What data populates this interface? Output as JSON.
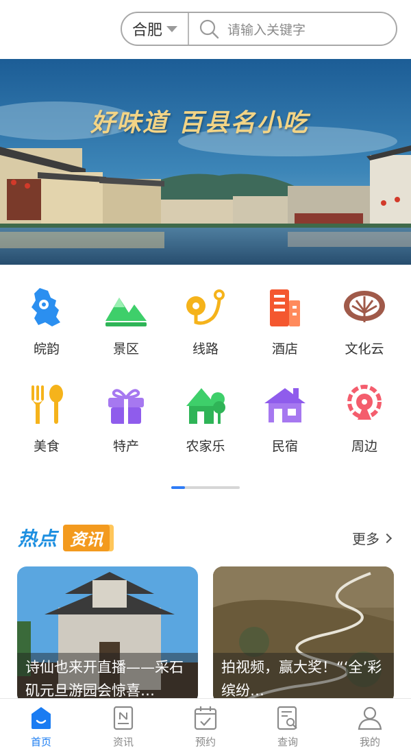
{
  "header": {
    "city": "合肥",
    "search_placeholder": "请输入关键字"
  },
  "banner": {
    "title": "好味道 百县名小吃"
  },
  "categories": [
    {
      "label": "皖韵",
      "icon": "anhui-map-icon"
    },
    {
      "label": "景区",
      "icon": "mountain-icon"
    },
    {
      "label": "线路",
      "icon": "route-icon"
    },
    {
      "label": "酒店",
      "icon": "hotel-icon"
    },
    {
      "label": "文化云",
      "icon": "culture-cloud-icon"
    },
    {
      "label": "美食",
      "icon": "fork-spoon-icon"
    },
    {
      "label": "特产",
      "icon": "gift-icon"
    },
    {
      "label": "农家乐",
      "icon": "farmhouse-icon"
    },
    {
      "label": "民宿",
      "icon": "homestay-icon"
    },
    {
      "label": "周边",
      "icon": "nearby-icon"
    }
  ],
  "hot_news": {
    "title_a": "热点",
    "title_b": "资讯",
    "more": "更多"
  },
  "news": [
    {
      "caption": "诗仙也来开直播——采石矶元旦游园会惊喜…"
    },
    {
      "caption": "拍视频，赢大奖！“‘全’彩缤纷…"
    }
  ],
  "tabbar": [
    {
      "label": "首页",
      "icon": "home-icon",
      "active": true
    },
    {
      "label": "资讯",
      "icon": "news-icon",
      "active": false
    },
    {
      "label": "预约",
      "icon": "calendar-icon",
      "active": false
    },
    {
      "label": "查询",
      "icon": "document-search-icon",
      "active": false
    },
    {
      "label": "我的",
      "icon": "user-icon",
      "active": false
    }
  ],
  "colors": {
    "accent": "#1a7cf2",
    "hot_blue": "#1d8fe0",
    "hot_orange": "#f39a1e"
  }
}
